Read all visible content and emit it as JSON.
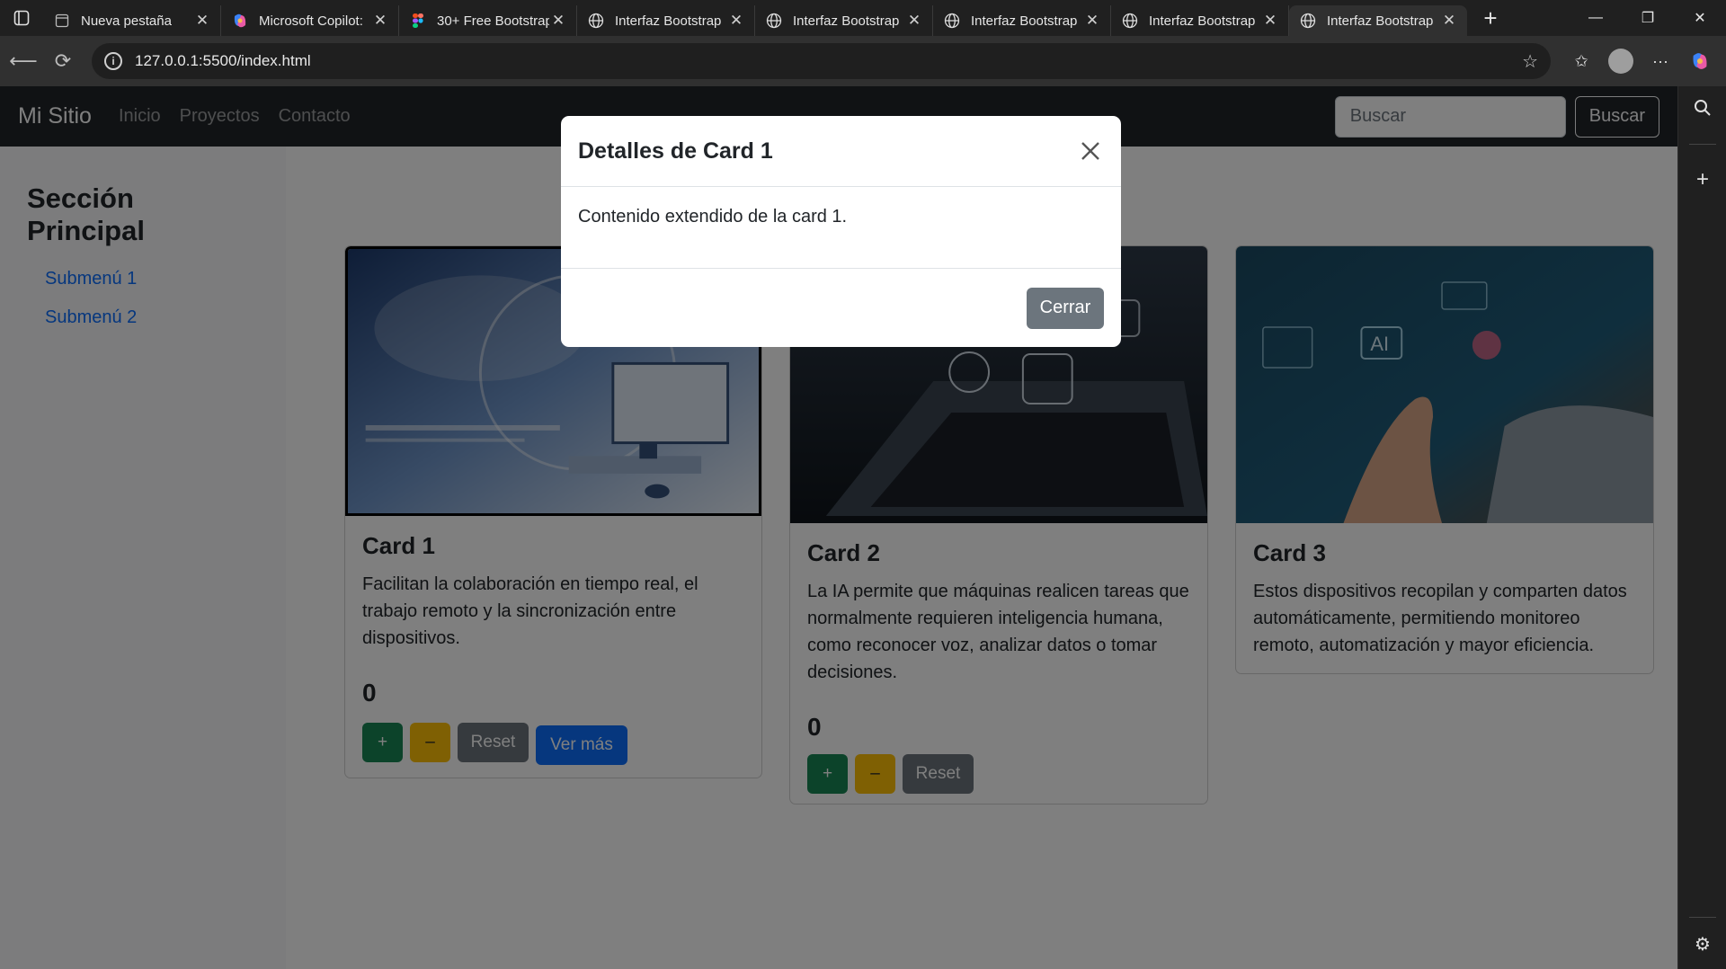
{
  "browser": {
    "tabs": [
      {
        "title": "Nueva pestaña",
        "icon": "blank-page-icon"
      },
      {
        "title": "Microsoft Copilot:",
        "icon": "copilot-icon"
      },
      {
        "title": "30+ Free Bootstrap",
        "icon": "figma-icon"
      },
      {
        "title": "Interfaz Bootstrap",
        "icon": "globe-icon"
      },
      {
        "title": "Interfaz Bootstrap",
        "icon": "globe-icon"
      },
      {
        "title": "Interfaz Bootstrap",
        "icon": "globe-icon"
      },
      {
        "title": "Interfaz Bootstrap",
        "icon": "globe-icon"
      },
      {
        "title": "Interfaz Bootstrap",
        "icon": "globe-icon",
        "active": true
      }
    ],
    "url": "127.0.0.1:5500/index.html"
  },
  "navbar": {
    "brand": "Mi Sitio",
    "links": [
      "Inicio",
      "Proyectos",
      "Contacto"
    ],
    "search_placeholder": "Buscar",
    "search_button": "Buscar"
  },
  "sidebar": {
    "title": "Sección Principal",
    "items": [
      "Submenú 1",
      "Submenú 2"
    ]
  },
  "cards": [
    {
      "title": "Card 1",
      "text": "Facilitan la colaboración en tiempo real, el trabajo remoto y la sincronización entre dispositivos.",
      "counter": "0",
      "plus": "+",
      "minus": "–",
      "reset": "Reset",
      "more": "Ver más"
    },
    {
      "title": "Card 2",
      "text": "La IA permite que máquinas realicen tareas que normalmente requieren inteligencia humana, como reconocer voz, analizar datos o tomar decisiones.",
      "counter": "0",
      "plus": "+",
      "minus": "–",
      "reset": "Reset"
    },
    {
      "title": "Card 3",
      "text": "Estos dispositivos recopilan y comparten datos automáticamente, permitiendo monitoreo remoto, automatización y mayor eficiencia."
    }
  ],
  "modal": {
    "title": "Detalles de Card 1",
    "body": "Contenido extendido de la card 1.",
    "close_button": "Cerrar"
  },
  "colors": {
    "primary": "#0d6efd",
    "success": "#198754",
    "warning": "#ffc107",
    "secondary": "#6c757d",
    "navbar": "#212529"
  }
}
